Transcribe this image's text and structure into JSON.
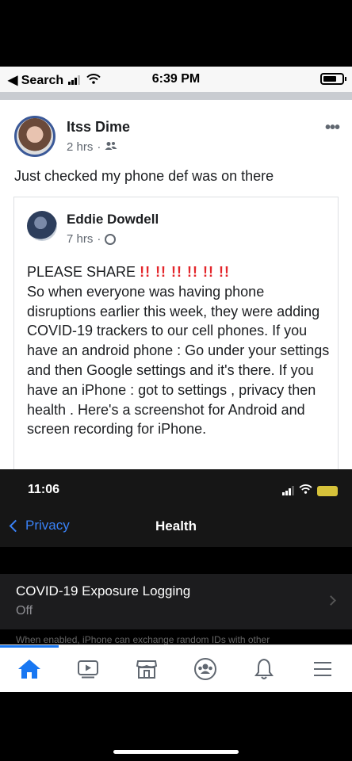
{
  "status_bar": {
    "back_app": "◀ Search",
    "time": "6:39 PM"
  },
  "post": {
    "author": "Itss Dime",
    "time": "2 hrs",
    "dot": "·",
    "more": "•••",
    "text": "Just checked my phone def was on there"
  },
  "shared_post": {
    "author": "Eddie Dowdell",
    "time": "7 hrs",
    "dot": "·",
    "please_share": "PLEASE SHARE",
    "exclamations": "!! !! !! !! !! !!",
    "body": "So when everyone was having phone disruptions earlier this week, they were adding COVID-19 trackers to our cell phones. If you have an android phone : Go under your settings and then Google settings and it's there. If you have an iPhone : got to settings , privacy then health . Here's a screenshot for Android and screen recording for iPhone."
  },
  "ios_screenshot": {
    "time": "11:06",
    "back_label": "Privacy",
    "title": "Health",
    "setting_label": "COVID-19 Exposure Logging",
    "setting_value": "Off",
    "footnote": "When enabled, iPhone can exchange random IDs with other"
  },
  "tabs": [
    {
      "name": "home",
      "icon": "home-icon",
      "active": true
    },
    {
      "name": "watch",
      "icon": "video-icon",
      "active": false
    },
    {
      "name": "marketplace",
      "icon": "marketplace-icon",
      "active": false
    },
    {
      "name": "groups",
      "icon": "groups-icon",
      "active": false
    },
    {
      "name": "notifications",
      "icon": "bell-icon",
      "active": false
    },
    {
      "name": "menu",
      "icon": "menu-icon",
      "active": false
    }
  ],
  "colors": {
    "facebook_blue": "#1877f2",
    "ios_link_blue": "#3a82f7",
    "exclamation_red": "#e3262b"
  }
}
